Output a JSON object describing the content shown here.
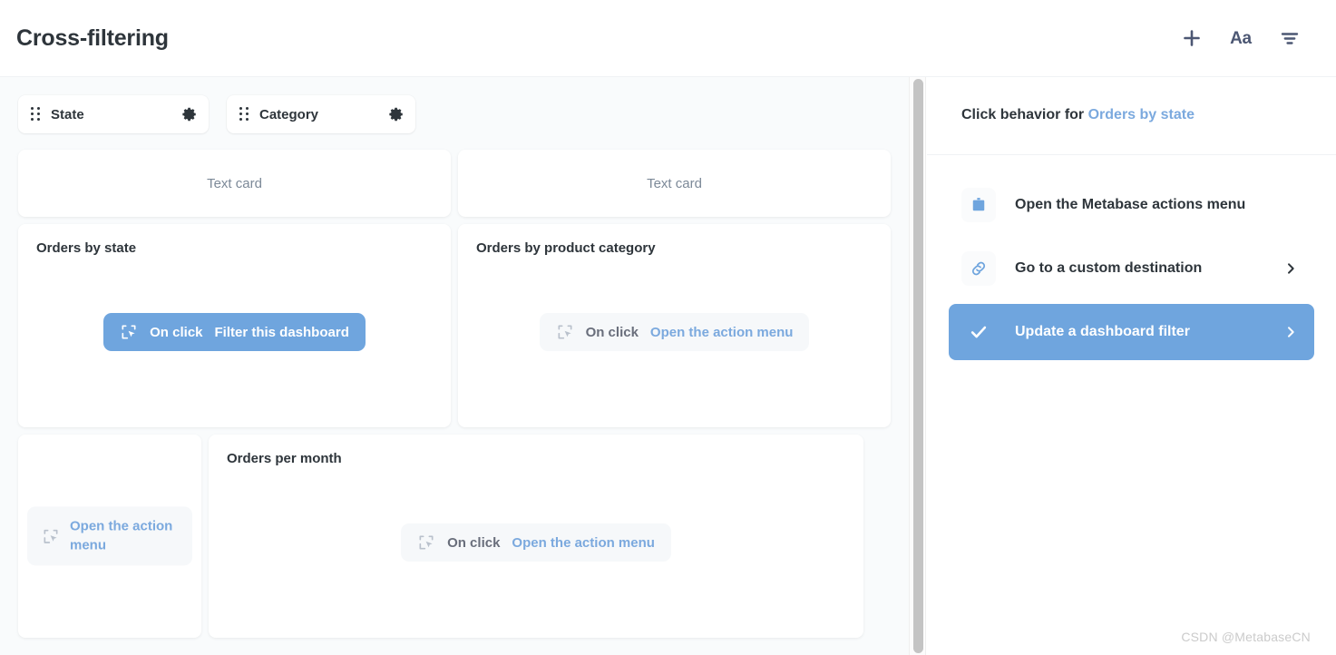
{
  "header": {
    "title": "Cross-filtering",
    "actions": [
      {
        "name": "add-icon",
        "label": "+"
      },
      {
        "name": "text-format-icon",
        "label": "Aa"
      },
      {
        "name": "filter-icon",
        "label": ""
      }
    ]
  },
  "colors": {
    "accent_blue": "#6FA5DE",
    "link_blue": "#7BA9DE",
    "text_dark": "#2E353B",
    "text_muted": "#7C8998",
    "canvas_bg": "#F9FBFC",
    "pill_inactive_bg": "#F6F8FA"
  },
  "dashboard": {
    "filters": [
      {
        "label": "State"
      },
      {
        "label": "Category"
      }
    ],
    "text_cards": [
      {
        "label": "Text card"
      },
      {
        "label": "Text card"
      }
    ],
    "cards": [
      {
        "title": "Orders by state",
        "on_click_label": "On click",
        "action_label": "Filter this dashboard",
        "active": true
      },
      {
        "title": "Orders by product category",
        "on_click_label": "On click",
        "action_label": "Open the action menu",
        "active": false
      },
      {
        "title": "",
        "on_click_label": "",
        "action_label": "Open the action menu",
        "active": false
      },
      {
        "title": "Orders per month",
        "on_click_label": "On click",
        "action_label": "Open the action menu",
        "active": false
      }
    ]
  },
  "sidebar": {
    "heading_prefix": "Click behavior for ",
    "heading_target": "Orders by state",
    "options": [
      {
        "label": "Open the Metabase actions menu",
        "icon": "actions-menu-icon",
        "selected": false,
        "has_chevron": false
      },
      {
        "label": "Go to a custom destination",
        "icon": "link-icon",
        "selected": false,
        "has_chevron": true
      },
      {
        "label": "Update a dashboard filter",
        "icon": "check-icon",
        "selected": true,
        "has_chevron": true
      }
    ]
  },
  "watermark": {
    "text": "CSDN @MetabaseCN"
  }
}
